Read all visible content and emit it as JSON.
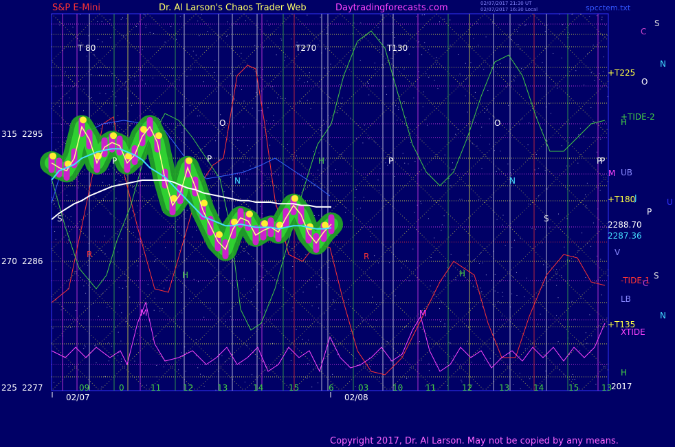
{
  "header": {
    "left": "S&P E-Mini",
    "center": "Dr. Al Larson's Chaos Trader Web",
    "site": "Daytradingforecasts.com",
    "stamp_line1": "02/07/2017 21:30 UT",
    "stamp_line2": "02/07/2017 16:30 Local",
    "file": "spcctem.txt"
  },
  "copyright": "Copyright 2017, Dr. Al Larson. May not be copied by any means.",
  "colors": {
    "background": "#000066",
    "plot_border": "#3333ff",
    "yellow_grid": "#ffff44",
    "magenta_grid": "#ff44ff",
    "green_tide": "#44cc44",
    "red_tide": "#ff3333",
    "cyan_avg": "#44ddff",
    "white_avg": "#ffffff",
    "price_fill": "#22aa22"
  },
  "chart_data": {
    "type": "line",
    "title": "S&P E-Mini",
    "y_left_labels": [
      {
        "level": "315",
        "price": "2295"
      },
      {
        "level": "270",
        "price": "2286"
      },
      {
        "level": "225",
        "price": "2277"
      }
    ],
    "ylim": [
      2277,
      2301
    ],
    "x_hour_ticks": [
      "09",
      "0",
      "11",
      "12",
      "13",
      "14",
      "15",
      "6",
      "03",
      "10",
      "11",
      "12",
      "13",
      "14",
      "15",
      "13"
    ],
    "date_labels": [
      "02/07",
      "02/08"
    ],
    "year_label": "2017",
    "top_markers": [
      "T 80",
      "T270",
      "T130"
    ],
    "right_labels": [
      {
        "text": "C",
        "color": "#cc44cc"
      },
      {
        "text": "S",
        "color": "#dddddd"
      },
      {
        "text": "N",
        "color": "#44ddff"
      },
      {
        "text": "O",
        "color": "#ffffff"
      },
      {
        "text": "+TIDE-2",
        "color": "#44cc44"
      },
      {
        "text": "H",
        "color": "#44cc44"
      },
      {
        "text": "P",
        "color": "#ffffff"
      },
      {
        "text": "M",
        "color": "#ff44ff"
      },
      {
        "text": "UB",
        "color": "#8888ff"
      },
      {
        "text": "J",
        "color": "#44ddff"
      },
      {
        "text": "U",
        "color": "#3333ff"
      },
      {
        "text": "P",
        "color": "#ffffff"
      },
      {
        "text": "V",
        "color": "#8888ff"
      },
      {
        "text": "S",
        "color": "#dddddd"
      },
      {
        "text": "-TIDE-1",
        "color": "#ff3333"
      },
      {
        "text": "C",
        "color": "#cc44cc"
      },
      {
        "text": "LB",
        "color": "#8888ff"
      },
      {
        "text": "N",
        "color": "#44ddff"
      },
      {
        "text": "XTIDE",
        "color": "#ff44ff"
      },
      {
        "text": "H",
        "color": "#44cc44"
      }
    ],
    "right_price_labels": [
      {
        "text": "+T225",
        "color": "#ffff44"
      },
      {
        "text": "+T180",
        "color": "#ffff44"
      },
      {
        "text": "2288.70",
        "color": "#ffffff"
      },
      {
        "text": "2287.36",
        "color": "#44ddff"
      },
      {
        "text": "+T135",
        "color": "#ffff44"
      }
    ],
    "plot_letters": [
      {
        "text": "O",
        "color": "#ffffff"
      },
      {
        "text": "P",
        "color": "#ffffff"
      },
      {
        "text": "N",
        "color": "#44ddff"
      },
      {
        "text": "H",
        "color": "#44cc44"
      },
      {
        "text": "M",
        "color": "#ff44ff"
      },
      {
        "text": "S",
        "color": "#dddddd"
      },
      {
        "text": "R",
        "color": "#ff3333"
      },
      {
        "text": "O",
        "color": "#ffffff"
      },
      {
        "text": "P",
        "color": "#ffffff"
      },
      {
        "text": "N",
        "color": "#44ddff"
      },
      {
        "text": "H",
        "color": "#44cc44"
      },
      {
        "text": "M",
        "color": "#ff44ff"
      },
      {
        "text": "S",
        "color": "#dddddd"
      },
      {
        "text": "R",
        "color": "#ff3333"
      },
      {
        "text": "P",
        "color": "#ffffff"
      },
      {
        "text": "H",
        "color": "#44cc44"
      },
      {
        "text": "P",
        "color": "#ffffff"
      }
    ],
    "series": [
      {
        "values": [
          2291.5,
          2291.2,
          2291.0,
          2291.8,
          2293.8,
          2293.0,
          2291.5,
          2292.5,
          2292.8,
          2292.6,
          2291.5,
          2292.0,
          2293.2,
          2293.8,
          2292.8,
          2290.5,
          2288.8,
          2289.5,
          2291.2,
          2290.0,
          2288.5,
          2287.5,
          2286.5,
          2286.0,
          2287.3,
          2288.0,
          2287.8,
          2286.9,
          2287.2,
          2287.4,
          2287.1,
          2288.0,
          2288.8,
          2288.2,
          2287.0,
          2286.4,
          2287.1,
          2287.6
        ]
      },
      {
        "values": [
          2290.4,
          2291.0,
          2291.2,
          2291.4,
          2291.8,
          2292.0,
          2292.2,
          2292.3,
          2292.4,
          2292.4,
          2292.2,
          2292.0,
          2291.7,
          2291.2,
          2290.9,
          2290.6,
          2290.1,
          2289.6,
          2289.1,
          2288.6,
          2288.1,
          2287.9,
          2287.7,
          2287.5,
          2287.5,
          2287.6,
          2287.5,
          2287.4,
          2287.4,
          2287.4,
          2287.3,
          2287.4,
          2287.5,
          2287.5,
          2287.4,
          2287.3,
          2287.3,
          2287.36
        ]
      },
      {
        "values": [
          2287.9,
          2288.3,
          2288.6,
          2288.9,
          2289.1,
          2289.4,
          2289.6,
          2289.8,
          2290.0,
          2290.1,
          2290.2,
          2290.3,
          2290.4,
          2290.4,
          2290.4,
          2290.4,
          2290.3,
          2290.1,
          2289.9,
          2289.8,
          2289.6,
          2289.5,
          2289.4,
          2289.3,
          2289.2,
          2289.1,
          2289.1,
          2289.0,
          2289.0,
          2289.0,
          2288.9,
          2288.9,
          2288.9,
          2288.8,
          2288.8,
          2288.7,
          2288.7,
          2288.7
        ]
      }
    ]
  }
}
